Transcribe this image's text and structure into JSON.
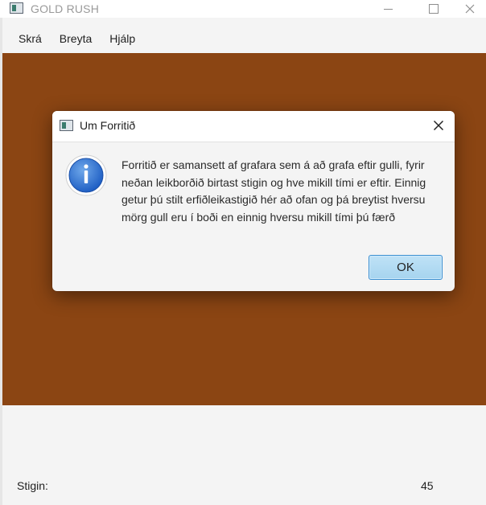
{
  "window": {
    "title": "GOLD RUSH",
    "minimize_icon": "minimize-icon",
    "maximize_icon": "maximize-icon",
    "close_icon": "close-icon"
  },
  "menubar": {
    "items": [
      {
        "label": "Skrá"
      },
      {
        "label": "Breyta"
      },
      {
        "label": "Hjálp"
      }
    ]
  },
  "game": {
    "background_color": "#8b4513"
  },
  "status": {
    "score_label": "Stigin:",
    "score_value": "45"
  },
  "dialog": {
    "title": "Um Forritið",
    "icon": "info-icon",
    "message": "Forritið er samansett af grafara sem á að grafa eftir gulli, fyrir neðan leikborðið birtast stigin og hve mikill tími er eftir. Einnig getur þú stilt erfiðleikastigið hér að ofan og þá breytist hversu mörg gull eru í boði en einnig hversu mikill tími þú færð",
    "ok_label": "OK"
  }
}
